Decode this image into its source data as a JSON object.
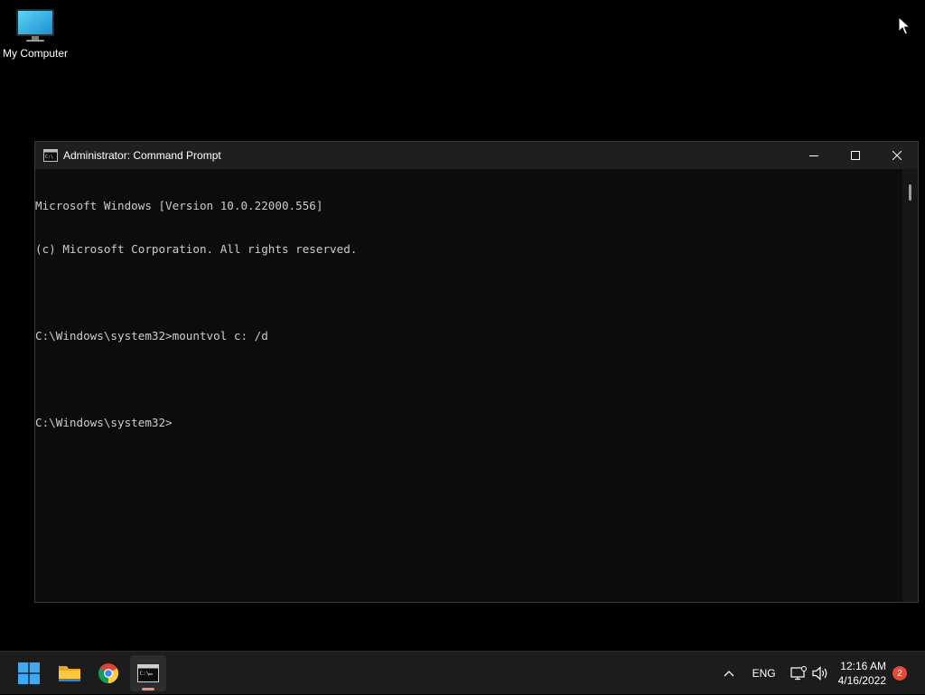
{
  "desktop": {
    "icons": [
      {
        "label": "My Computer",
        "icon": "monitor-icon"
      }
    ]
  },
  "window": {
    "title": "Administrator: Command Prompt",
    "icon": "cmd-icon",
    "controls": {
      "minimize": "minimize-icon",
      "maximize": "maximize-icon",
      "close": "close-icon"
    },
    "console_lines": [
      "Microsoft Windows [Version 10.0.22000.556]",
      "(c) Microsoft Corporation. All rights reserved.",
      "",
      "C:\\Windows\\system32>mountvol c: /d",
      "",
      "C:\\Windows\\system32>"
    ]
  },
  "taskbar": {
    "apps": [
      {
        "name": "start",
        "icon": "windows-start-icon"
      },
      {
        "name": "file-explorer",
        "icon": "folder-icon"
      },
      {
        "name": "chrome",
        "icon": "chrome-icon"
      },
      {
        "name": "command-prompt",
        "icon": "cmd-icon",
        "active": true
      }
    ],
    "tray": {
      "language": "ENG",
      "time": "12:16 AM",
      "date": "4/16/2022",
      "notification_count": "2"
    }
  },
  "colors": {
    "console_text": "#cccccc",
    "console_bg": "#0c0c0c",
    "titlebar_bg": "#1f1f1f",
    "taskbar_bg": "#1c1c1c",
    "badge": "#e04a3a",
    "active_indicator": "#f08a7a"
  }
}
